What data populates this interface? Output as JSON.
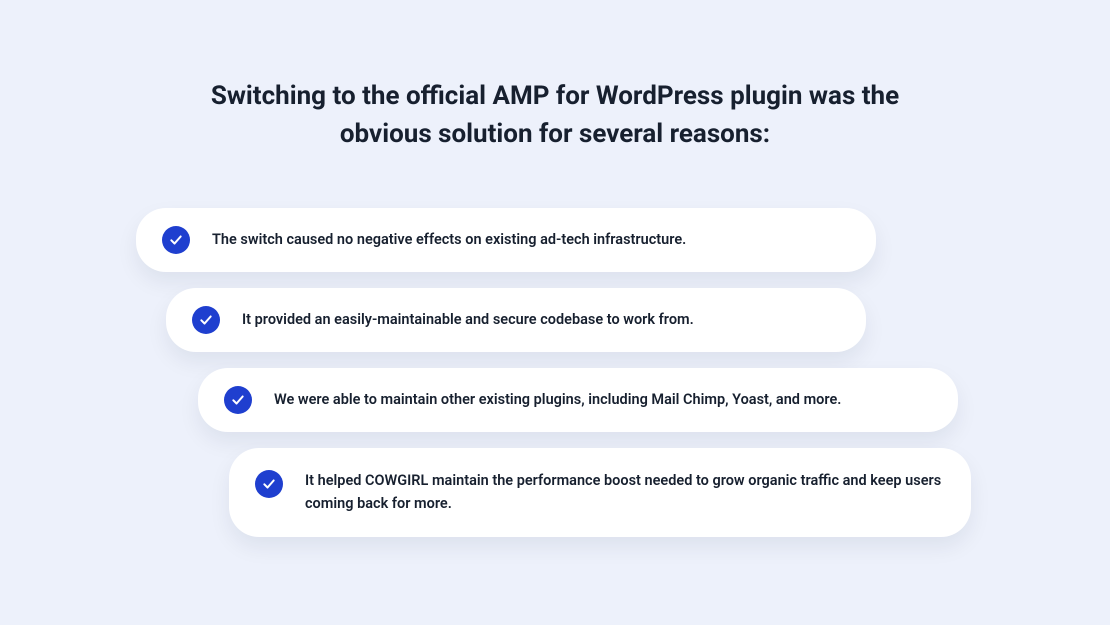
{
  "heading": "Switching to the official AMP for WordPress plugin was the obvious solution for several reasons:",
  "reasons": [
    "The switch caused no negative effects on existing ad-tech infrastructure.",
    "It provided an easily-maintainable and secure codebase to work from.",
    "We were able to maintain other existing plugins, including Mail Chimp, Yoast, and more.",
    "It helped COWGIRL maintain the performance boost needed to grow organic traffic and keep users coming back for more."
  ]
}
